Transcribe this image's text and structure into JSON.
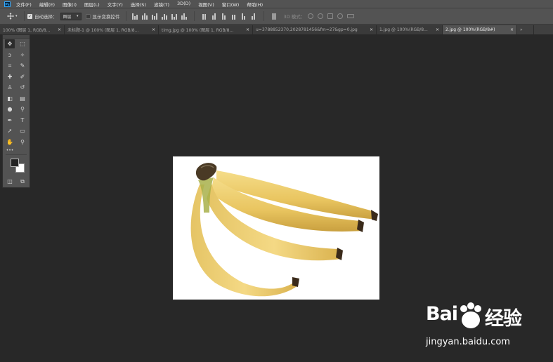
{
  "app": {
    "logo": "Ps"
  },
  "menu": [
    "文件(F)",
    "编辑(E)",
    "图像(I)",
    "图层(L)",
    "文字(Y)",
    "选择(S)",
    "滤镜(T)",
    "3D(D)",
    "视图(V)",
    "窗口(W)",
    "帮助(H)"
  ],
  "options": {
    "tool_icon": "move-icon",
    "auto_select_label": "自动选择：",
    "auto_select_checked": true,
    "auto_select_target": "图层",
    "show_transform_label": "显示变换控件",
    "show_transform_checked": false,
    "mode_3d_label": "3D 模式："
  },
  "tabs": [
    {
      "title": "100% (图层 1, RGB/8...",
      "active": false
    },
    {
      "title": "未标题-1 @ 100% (图层 1, RGB/8...",
      "active": false
    },
    {
      "title": "timg.jpg @ 100% (图层 1, RGB/8...",
      "active": false
    },
    {
      "title": "u=3788852370,2028781456&fm=27&gp=0.jpg",
      "active": false
    },
    {
      "title": "1.jpg @ 100%(RGB/8...",
      "active": false
    },
    {
      "title": "2.jpg @ 100%(RGB/8#)",
      "active": true
    }
  ],
  "tab_close_glyph": "×",
  "toolbox": {
    "tools": [
      {
        "name": "move-tool-icon",
        "glyph": "✥",
        "selected": true
      },
      {
        "name": "marquee-tool-icon",
        "glyph": "⬚",
        "selected": false
      },
      {
        "name": "lasso-tool-icon",
        "glyph": "ↄ",
        "selected": false
      },
      {
        "name": "magic-wand-tool-icon",
        "glyph": "✧",
        "selected": false
      },
      {
        "name": "crop-tool-icon",
        "glyph": "⌗",
        "selected": false
      },
      {
        "name": "eyedropper-tool-icon",
        "glyph": "✎",
        "selected": false
      },
      {
        "name": "healing-brush-tool-icon",
        "glyph": "✚",
        "selected": false
      },
      {
        "name": "brush-tool-icon",
        "glyph": "✐",
        "selected": false
      },
      {
        "name": "clone-stamp-tool-icon",
        "glyph": "♙",
        "selected": false
      },
      {
        "name": "history-brush-tool-icon",
        "glyph": "↺",
        "selected": false
      },
      {
        "name": "eraser-tool-icon",
        "glyph": "◧",
        "selected": false
      },
      {
        "name": "gradient-tool-icon",
        "glyph": "▤",
        "selected": false
      },
      {
        "name": "blur-tool-icon",
        "glyph": "●",
        "selected": false
      },
      {
        "name": "dodge-tool-icon",
        "glyph": "⚲",
        "selected": false
      },
      {
        "name": "pen-tool-icon",
        "glyph": "✒",
        "selected": false
      },
      {
        "name": "type-tool-icon",
        "glyph": "T",
        "selected": false
      },
      {
        "name": "path-selection-tool-icon",
        "glyph": "➚",
        "selected": false
      },
      {
        "name": "rectangle-tool-icon",
        "glyph": "▭",
        "selected": false
      },
      {
        "name": "hand-tool-icon",
        "glyph": "✋",
        "selected": false
      },
      {
        "name": "zoom-tool-icon",
        "glyph": "⚲",
        "selected": false
      }
    ],
    "more_glyph": "•••",
    "quick_mask_glyph": "◫",
    "screen_mode_glyph": "⧉"
  },
  "colors": {
    "foreground": "#222222",
    "background": "#ffffff",
    "ui_bg": "#282828",
    "panel": "#535353"
  },
  "watermark": {
    "brand": "Bai",
    "brand_cn": "经验",
    "url": "jingyan.baidu.com"
  }
}
